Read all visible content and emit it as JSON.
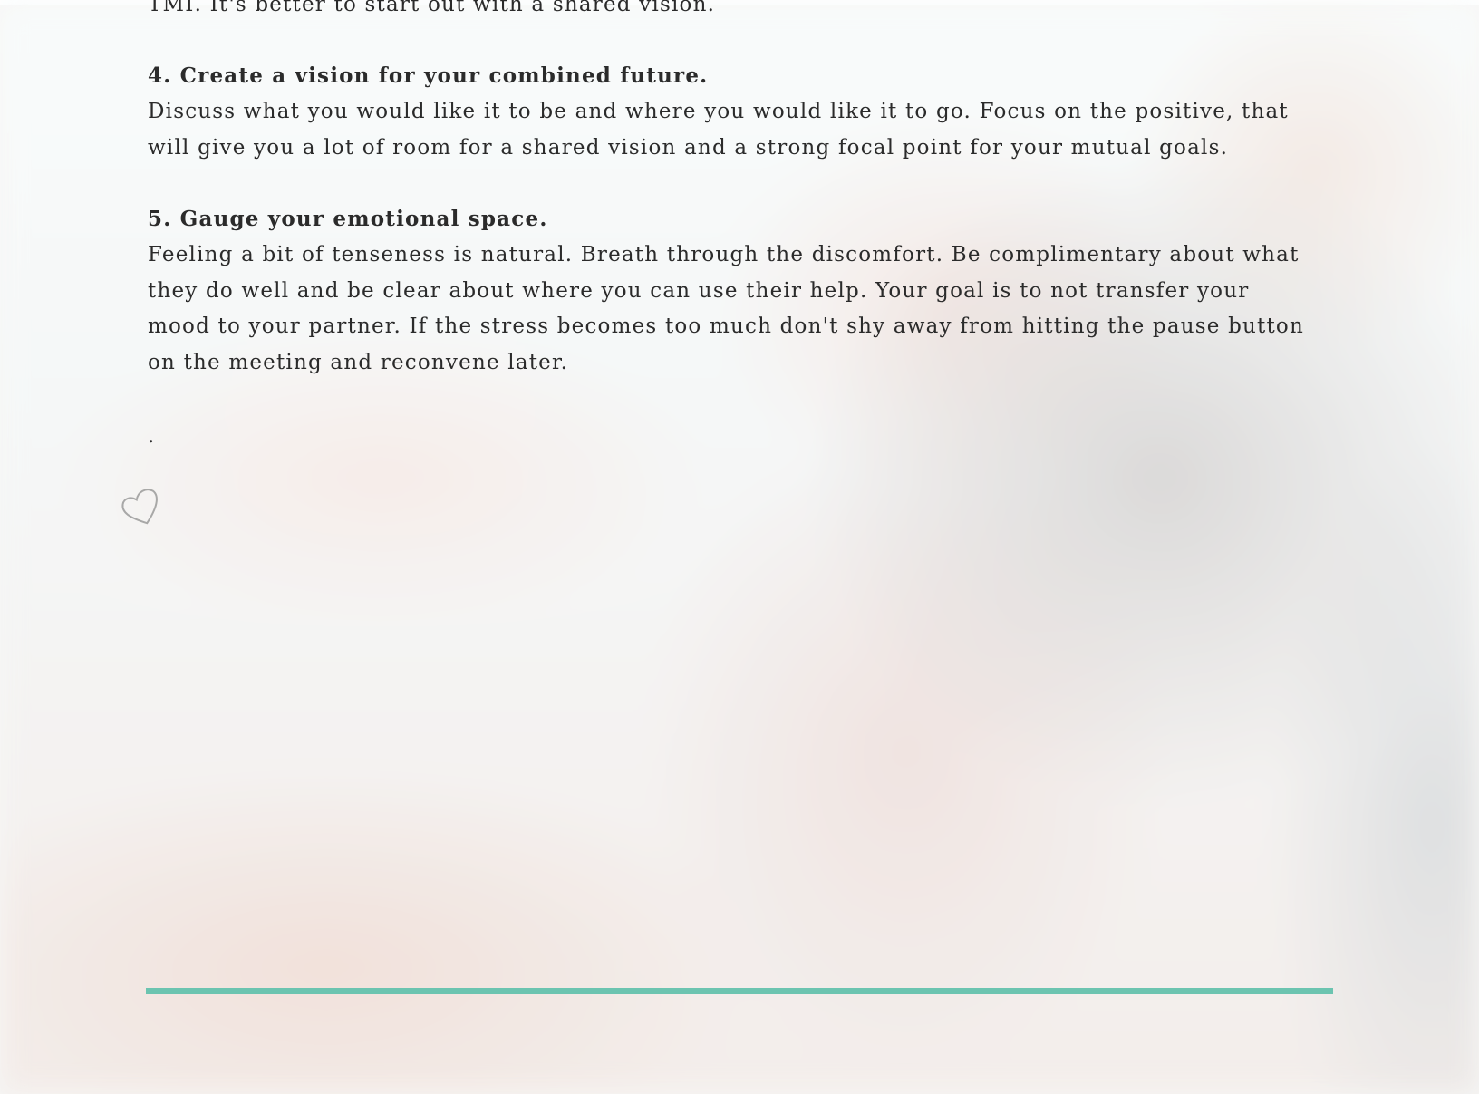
{
  "article": {
    "cut_off_line": "TMI. It's better to start out with a shared vision.",
    "tip4": {
      "heading": "4. Create a vision for your combined future.",
      "body": "Discuss what you would like it to be and where you would like it to go. Focus on the positive, that will give you a lot of room for a shared vision and a strong focal point for your mutual goals."
    },
    "tip5": {
      "heading": "5. Gauge your emotional space.",
      "body": "Feeling a bit of tenseness is natural. Breath through the discomfort. Be complimentary about what they do well and be clear about where you can use their help. Your goal is to not transfer your mood to your partner. If the stress becomes too much don't shy away from hitting the pause button on the meeting and reconvene later."
    },
    "trailing_mark": "."
  },
  "colors": {
    "text": "#2b2b2b",
    "divider_accent": "#6cc4b0"
  },
  "icons": {
    "wrist_tattoo": "heart-outline-icon"
  }
}
